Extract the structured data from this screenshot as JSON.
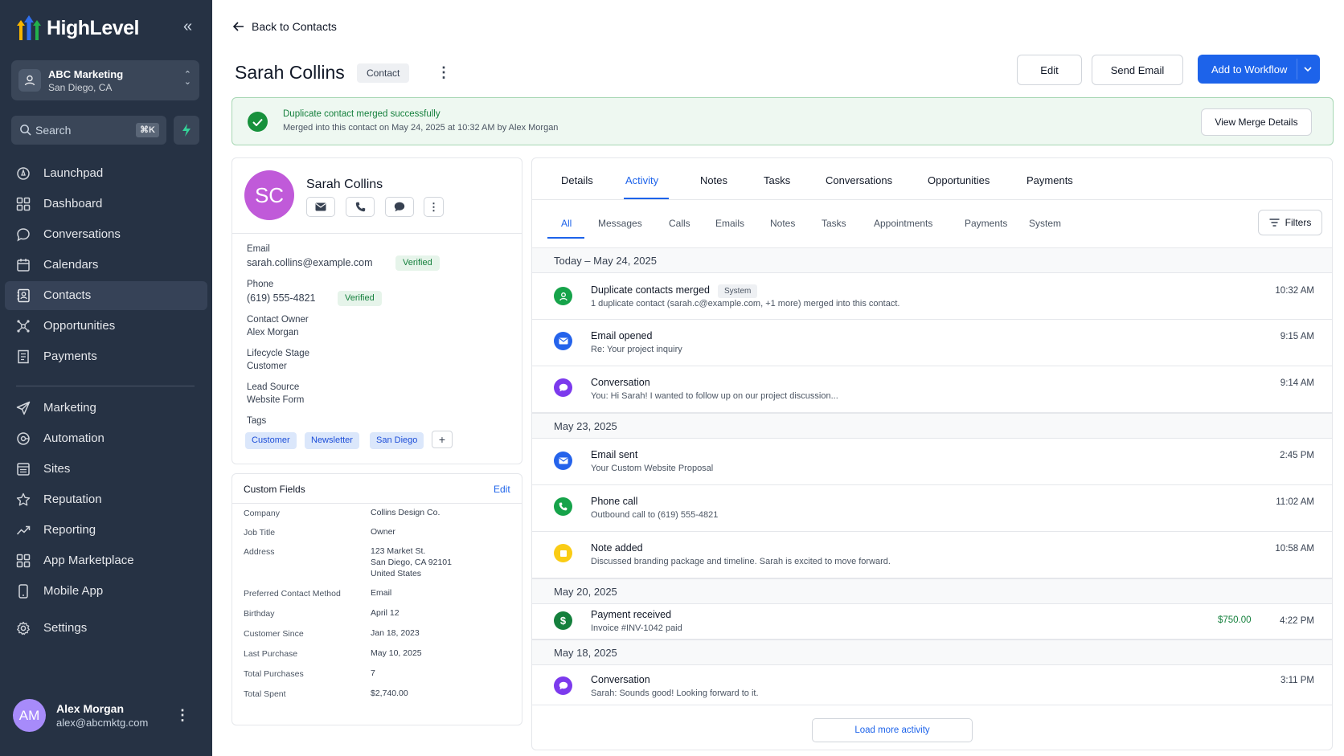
{
  "brand": {
    "name": "HighLevel"
  },
  "account": {
    "name": "ABC Marketing",
    "location": "San Diego, CA"
  },
  "search": {
    "placeholder": "Search",
    "shortcut": "⌘K"
  },
  "nav": {
    "items": [
      {
        "label": "Launchpad",
        "icon": "rocket-icon"
      },
      {
        "label": "Dashboard",
        "icon": "grid-icon"
      },
      {
        "label": "Conversations",
        "icon": "chat-icon"
      },
      {
        "label": "Calendars",
        "icon": "calendar-icon"
      },
      {
        "label": "Contacts",
        "icon": "contacts-icon",
        "active": true
      },
      {
        "label": "Opportunities",
        "icon": "network-icon"
      },
      {
        "label": "Payments",
        "icon": "receipt-icon"
      }
    ],
    "items2": [
      {
        "label": "Marketing",
        "icon": "send-icon"
      },
      {
        "label": "Automation",
        "icon": "automation-icon"
      },
      {
        "label": "Sites",
        "icon": "sites-icon"
      },
      {
        "label": "Reputation",
        "icon": "star-icon"
      },
      {
        "label": "Reporting",
        "icon": "trend-icon"
      },
      {
        "label": "App Marketplace",
        "icon": "apps-icon"
      },
      {
        "label": "Mobile App",
        "icon": "phone-device-icon"
      },
      {
        "label": "Settings",
        "icon": "gear-icon"
      }
    ]
  },
  "user": {
    "initials": "AM",
    "name": "Alex Morgan",
    "email": "alex@abcmktg.com"
  },
  "header": {
    "back_label": "Back to Contacts",
    "title": "Sarah Collins",
    "type_badge": "Contact",
    "edit_label": "Edit",
    "send_email_label": "Send Email",
    "workflow_label": "Add to Workflow"
  },
  "banner": {
    "title": "Duplicate contact merged successfully",
    "subtitle": "Merged into this contact on May 24, 2025 at 10:32 AM by Alex Morgan",
    "action": "View Merge Details"
  },
  "profile": {
    "initials": "SC",
    "name": "Sarah Collins",
    "email_label": "Email",
    "email": "sarah.collins@example.com",
    "email_status": "Verified",
    "phone_label": "Phone",
    "phone": "(619) 555-4821",
    "phone_status": "Verified",
    "owner_label": "Contact Owner",
    "owner": "Alex Morgan",
    "stage_label": "Lifecycle Stage",
    "stage": "Customer",
    "source_label": "Lead Source",
    "source": "Website Form",
    "tags_label": "Tags",
    "tags": [
      "Customer",
      "Newsletter",
      "San Diego"
    ],
    "add_tag": "+"
  },
  "custom_fields": {
    "title": "Custom Fields",
    "edit": "Edit",
    "rows": [
      {
        "key": "Company",
        "value": "Collins Design Co."
      },
      {
        "key": "Job Title",
        "value": "Owner"
      },
      {
        "key": "Address",
        "value": "123 Market St.",
        "value2": "San Diego, CA 92101",
        "value3": "United States"
      },
      {
        "key": "Preferred Contact Method",
        "value": "Email"
      },
      {
        "key": "Birthday",
        "value": "April 12"
      },
      {
        "key": "Customer Since",
        "value": "Jan 18, 2023"
      },
      {
        "key": "Last Purchase",
        "value": "May 10, 2025"
      },
      {
        "key": "Total Purchases",
        "value": "7"
      },
      {
        "key": "Total Spent",
        "value": "$2,740.00"
      }
    ]
  },
  "tabs": [
    "Details",
    "Activity",
    "Notes",
    "Tasks",
    "Conversations",
    "Opportunities",
    "Payments"
  ],
  "subtabs": [
    "All",
    "Messages",
    "Calls",
    "Emails",
    "Notes",
    "Tasks",
    "Appointments",
    "Payments",
    "System"
  ],
  "filters_label": "Filters",
  "activity": {
    "days": [
      "Today – May 24, 2025",
      "May 23, 2025",
      "May 20, 2025",
      "May 18, 2025"
    ],
    "items": [
      {
        "title": "Duplicate contacts merged",
        "badge": "System",
        "subtitle": "1 duplicate contact (sarah.c@example.com, +1 more) merged into this contact.",
        "time": "10:32 AM",
        "color": "#16a34a",
        "icon": "user-merge-icon"
      },
      {
        "title": "Email opened",
        "subtitle": "Re: Your project inquiry",
        "time": "9:15 AM",
        "color": "#2563eb",
        "icon": "email-icon"
      },
      {
        "title": "Conversation",
        "subtitle": "You: Hi Sarah! I wanted to follow up on our project discussion...",
        "time": "9:14 AM",
        "color": "#7c3aed",
        "icon": "chat-icon"
      },
      {
        "title": "Email sent",
        "subtitle": "Your Custom Website Proposal",
        "time": "2:45 PM",
        "color": "#2563eb",
        "icon": "email-icon"
      },
      {
        "title": "Phone call",
        "subtitle": "Outbound call to (619) 555-4821",
        "time": "11:02 AM",
        "color": "#16a34a",
        "icon": "phone-icon"
      },
      {
        "title": "Note added",
        "subtitle": "Discussed branding package and timeline. Sarah is excited to move forward.",
        "time": "10:58 AM",
        "color": "#facc15",
        "icon": "note-icon"
      },
      {
        "title": "Payment received",
        "subtitle": "Invoice #INV-1042 paid",
        "amount": "$750.00",
        "time": "4:22 PM",
        "color": "#15803d",
        "icon": "dollar-icon"
      },
      {
        "title": "Conversation",
        "subtitle": "Sarah: Sounds good! Looking forward to it.",
        "time": "3:11 PM",
        "color": "#7c3aed",
        "icon": "chat-icon"
      }
    ],
    "load_more": "Load more activity"
  }
}
